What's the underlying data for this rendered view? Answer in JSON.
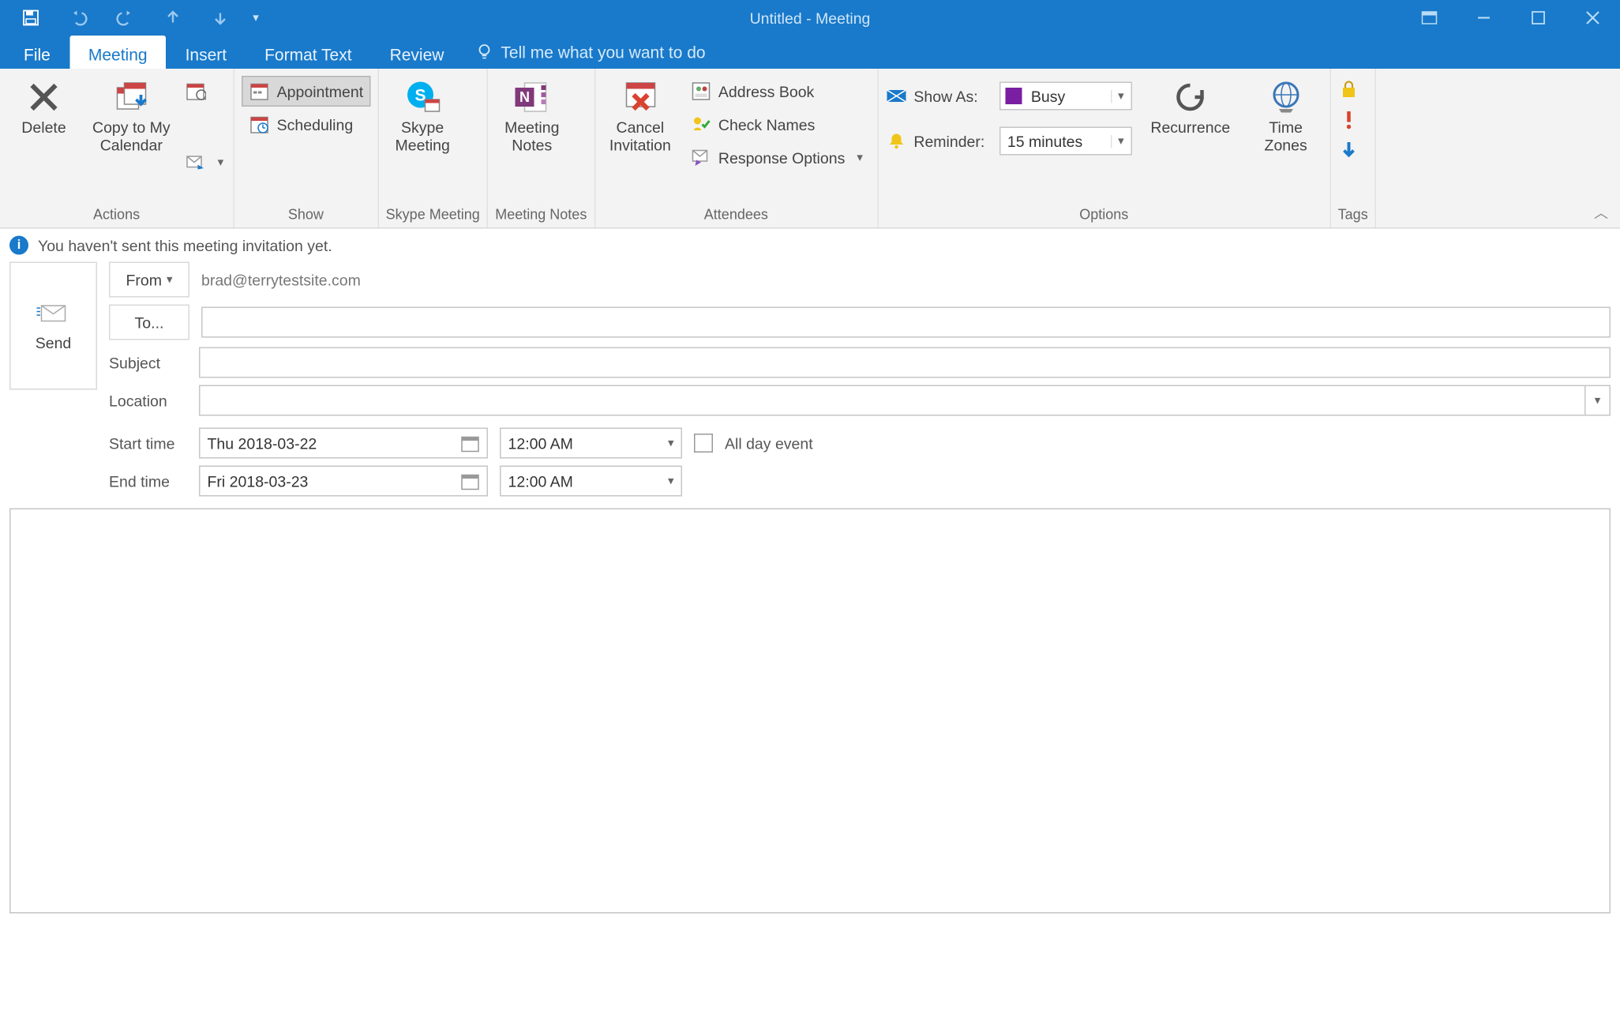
{
  "window": {
    "title": "Untitled  -  Meeting"
  },
  "tabs": {
    "file": "File",
    "meeting": "Meeting",
    "insert": "Insert",
    "format_text": "Format Text",
    "review": "Review",
    "tellme": "Tell me what you want to do"
  },
  "ribbon": {
    "actions": {
      "group_label": "Actions",
      "delete": "Delete",
      "copy_to_my_calendar": "Copy to My\nCalendar"
    },
    "show": {
      "group_label": "Show",
      "appointment": "Appointment",
      "scheduling": "Scheduling"
    },
    "skype": {
      "group_label": "Skype Meeting",
      "skype_meeting": "Skype\nMeeting"
    },
    "notes": {
      "group_label": "Meeting Notes",
      "meeting_notes": "Meeting\nNotes"
    },
    "attendees": {
      "group_label": "Attendees",
      "cancel_invitation": "Cancel\nInvitation",
      "address_book": "Address Book",
      "check_names": "Check Names",
      "response_options": "Response Options"
    },
    "options": {
      "group_label": "Options",
      "show_as_label": "Show As:",
      "show_as_value": "Busy",
      "reminder_label": "Reminder:",
      "reminder_value": "15 minutes",
      "recurrence": "Recurrence",
      "time_zones": "Time\nZones"
    },
    "tags": {
      "group_label": "Tags"
    }
  },
  "infobar": {
    "text": "You haven't sent this meeting invitation yet."
  },
  "form": {
    "send": "Send",
    "from_label": "From",
    "from_value": "brad@terrytestsite.com",
    "to_label": "To...",
    "to_value": "",
    "subject_label": "Subject",
    "subject_value": "",
    "location_label": "Location",
    "location_value": "",
    "start_label": "Start time",
    "start_date": "Thu 2018-03-22",
    "start_time": "12:00 AM",
    "end_label": "End time",
    "end_date": "Fri 2018-03-23",
    "end_time": "12:00 AM",
    "all_day_label": "All day event",
    "all_day_checked": false
  },
  "colors": {
    "accent": "#1979ca",
    "busy_swatch": "#6b3fa0",
    "ribbon_bg": "#f3f3f3"
  }
}
